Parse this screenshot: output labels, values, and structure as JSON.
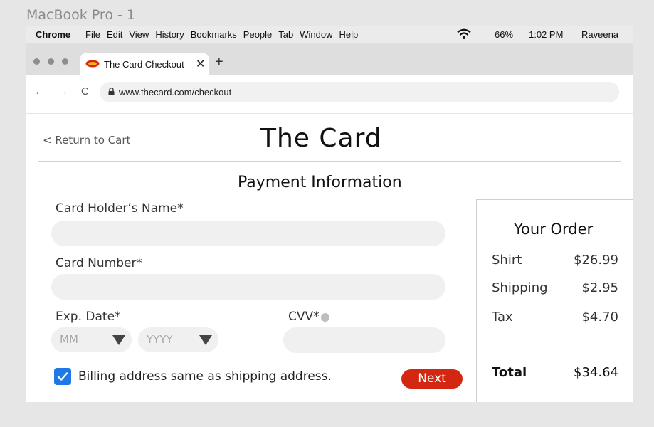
{
  "frame_label": "MacBook Pro - 1",
  "menubar": {
    "app": "Chrome",
    "items": [
      "File",
      "Edit",
      "View",
      "History",
      "Bookmarks",
      "People",
      "Tab",
      "Window",
      "Help"
    ],
    "battery": "66%",
    "clock": "1:02 PM",
    "user": "Raveena"
  },
  "tab": {
    "title": "The Card Checkout",
    "close": "✕",
    "new_tab": "+"
  },
  "address": {
    "back": "←",
    "forward": "→",
    "reload": "C",
    "url": "www.thecard.com/checkout"
  },
  "page": {
    "return_link": "<  Return to Cart",
    "brand": "The  Card",
    "section_title": "Payment Information",
    "name_label": "Card Holder’s Name*",
    "number_label": "Card Number*",
    "exp_label": "Exp. Date*",
    "cvv_label": "CVV*",
    "cvv_info": "i",
    "month_placeholder": "MM",
    "year_placeholder": "YYYY",
    "billing_label": "Billing address same as shipping address.",
    "billing_checked": true,
    "next_label": "Next"
  },
  "order": {
    "title": "Your Order",
    "lines": [
      {
        "label": "Shirt",
        "value": "$26.99"
      },
      {
        "label": "Shipping",
        "value": "$2.95"
      },
      {
        "label": "Tax",
        "value": "$4.70"
      }
    ],
    "total_label": "Total",
    "total_value": "$34.64"
  },
  "colors": {
    "next_button": "#d42711",
    "checkbox": "#1f78e6",
    "divider": "#e7d28a"
  }
}
